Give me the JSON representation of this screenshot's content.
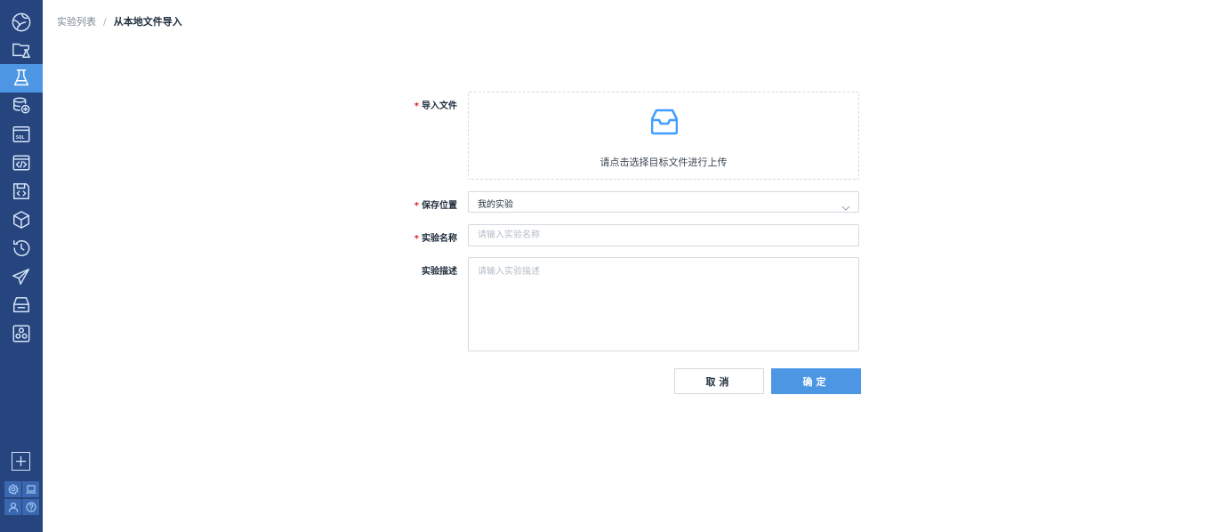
{
  "sidebar": {
    "items": [
      {
        "icon": "globe-icon",
        "active": false
      },
      {
        "icon": "folder-flask-icon",
        "active": false
      },
      {
        "icon": "flask-icon",
        "active": true
      },
      {
        "icon": "database-stack-icon",
        "active": false
      },
      {
        "icon": "sql-icon",
        "active": false
      },
      {
        "icon": "code-window-icon",
        "active": false
      },
      {
        "icon": "code-save-icon",
        "active": false
      },
      {
        "icon": "cube-icon",
        "active": false
      },
      {
        "icon": "history-icon",
        "active": false
      },
      {
        "icon": "send-icon",
        "active": false
      },
      {
        "icon": "inbox-tray-icon",
        "active": false
      },
      {
        "icon": "cluster-icon",
        "active": false
      }
    ],
    "add_icon": "plus-box-icon",
    "bottom_icons": [
      "settings-icon",
      "laptop-icon",
      "user-icon",
      "help-icon"
    ]
  },
  "breadcrumb": {
    "parent": "实验列表",
    "separator": "/",
    "current": "从本地文件导入"
  },
  "form": {
    "import_file": {
      "label": "导入文件",
      "required": true,
      "upload_hint": "请点击选择目标文件进行上传",
      "icon": "inbox-upload-icon"
    },
    "save_location": {
      "label": "保存位置",
      "required": true,
      "value": "我的实验"
    },
    "experiment_name": {
      "label": "实验名称",
      "required": true,
      "value": "",
      "placeholder": "请输入实验名称"
    },
    "experiment_desc": {
      "label": "实验描述",
      "required": false,
      "value": "",
      "placeholder": "请输入实验描述"
    },
    "cancel_label": "取消",
    "confirm_label": "确定"
  },
  "colors": {
    "sidebar_bg": "#26457f",
    "accent": "#4d96e4",
    "required_mark": "#e02424",
    "upload_icon": "#409eff"
  }
}
